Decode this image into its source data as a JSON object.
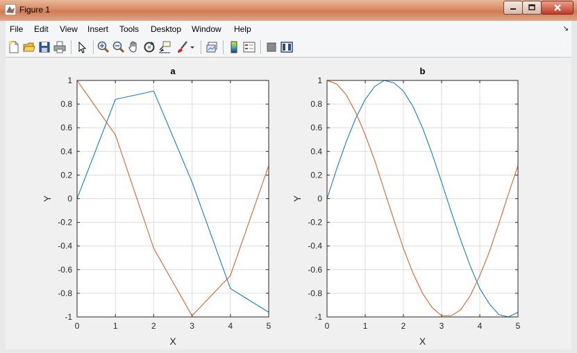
{
  "window": {
    "title": "Figure 1"
  },
  "menu": [
    "File",
    "Edit",
    "View",
    "Insert",
    "Tools",
    "Desktop",
    "Window",
    "Help"
  ],
  "toolbar": {
    "icons": [
      "new-file-icon",
      "open-folder-icon",
      "save-icon",
      "print-icon",
      "pointer-icon",
      "zoom-in-icon",
      "zoom-out-icon",
      "pan-hand-icon",
      "rotate-3d-icon",
      "data-cursor-icon",
      "brush-icon",
      "brush-dropdown-icon",
      "link-plot-icon",
      "insert-colorbar-icon",
      "insert-legend-icon",
      "hide-plot-tools-icon",
      "show-plot-tools-icon"
    ]
  },
  "colors": {
    "series1": "#0072BD",
    "series2": "#D95319",
    "grid": "#dcdcdc",
    "axes": "#262626"
  },
  "chart_data": [
    {
      "type": "line",
      "title": "a",
      "xlabel": "X",
      "ylabel": "Y",
      "xlim": [
        0,
        5
      ],
      "ylim": [
        -1,
        1
      ],
      "xticks": [
        "0",
        "1",
        "2",
        "3",
        "4",
        "5"
      ],
      "yticks": [
        "-1",
        "-0.8",
        "-0.6",
        "-0.4",
        "-0.2",
        "0",
        "0.2",
        "0.4",
        "0.6",
        "0.8",
        "1"
      ],
      "grid": true,
      "series": [
        {
          "x": [
            0,
            1,
            2,
            3,
            4,
            5
          ],
          "values": [
            0,
            0.84,
            0.91,
            0.14,
            -0.76,
            -0.96
          ]
        },
        {
          "x": [
            0,
            1,
            2,
            3,
            4,
            5
          ],
          "values": [
            1,
            0.54,
            -0.42,
            -0.99,
            -0.65,
            0.28
          ]
        }
      ]
    },
    {
      "type": "line",
      "title": "b",
      "xlabel": "X",
      "ylabel": "Y",
      "xlim": [
        0,
        5
      ],
      "ylim": [
        -1,
        1
      ],
      "xticks": [
        "0",
        "1",
        "2",
        "3",
        "4",
        "5"
      ],
      "yticks": [
        "-1",
        "-0.8",
        "-0.6",
        "-0.4",
        "-0.2",
        "0",
        "0.2",
        "0.4",
        "0.6",
        "0.8",
        "1"
      ],
      "grid": true,
      "series": [
        {
          "x": [
            0,
            0.25,
            0.5,
            0.75,
            1,
            1.25,
            1.5,
            1.75,
            2,
            2.25,
            2.5,
            2.75,
            3,
            3.25,
            3.5,
            3.75,
            4,
            4.25,
            4.5,
            4.75,
            5
          ],
          "values": [
            0,
            0.25,
            0.48,
            0.68,
            0.84,
            0.95,
            1,
            0.98,
            0.91,
            0.78,
            0.6,
            0.38,
            0.14,
            -0.11,
            -0.35,
            -0.57,
            -0.76,
            -0.89,
            -0.98,
            -1,
            -0.96
          ]
        },
        {
          "x": [
            0,
            0.25,
            0.5,
            0.75,
            1,
            1.25,
            1.5,
            1.75,
            2,
            2.25,
            2.5,
            2.75,
            3,
            3.25,
            3.5,
            3.75,
            4,
            4.25,
            4.5,
            4.75,
            5
          ],
          "values": [
            1,
            0.97,
            0.88,
            0.73,
            0.54,
            0.32,
            0.07,
            -0.18,
            -0.42,
            -0.63,
            -0.8,
            -0.92,
            -0.99,
            -0.99,
            -0.94,
            -0.82,
            -0.65,
            -0.45,
            -0.21,
            0.04,
            0.28
          ]
        }
      ]
    }
  ]
}
